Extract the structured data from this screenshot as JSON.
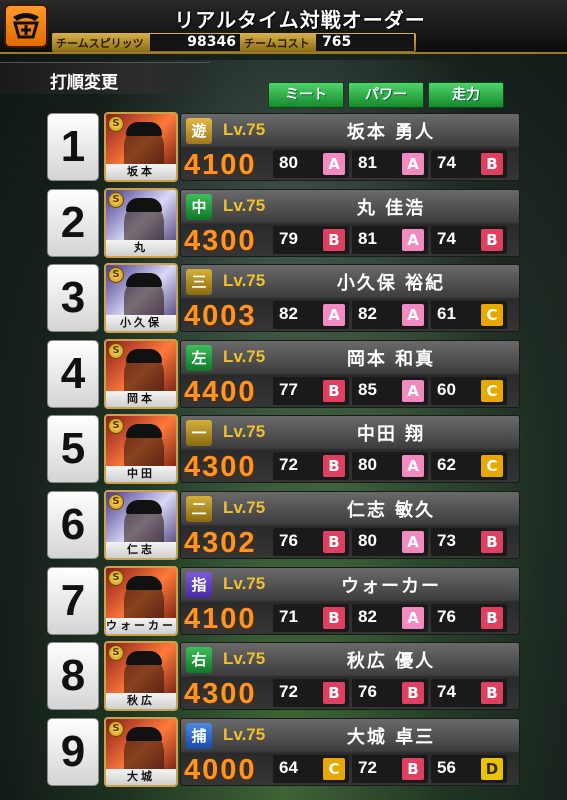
{
  "header": {
    "title": "リアルタイム対戦オーダー",
    "spirit_label": "チームスピリッツ",
    "spirit_value": "98346",
    "cost_label": "チームコスト",
    "cost_value": "765",
    "logo_icon": "giants-logo-icon"
  },
  "tab": {
    "label": "打順変更"
  },
  "sort_buttons": [
    {
      "label": "ミート"
    },
    {
      "label": "パワー"
    },
    {
      "label": "走力"
    }
  ],
  "players": [
    {
      "order": "1",
      "position": "遊",
      "pos_class": "pos-ss",
      "level": "Lv.75",
      "name": "坂本 勇人",
      "card_name": "坂本",
      "power": "4100",
      "meet": "80",
      "meet_grade": "A",
      "pwr": "81",
      "pwr_grade": "A",
      "speed": "74",
      "speed_grade": "B",
      "portrait": "p-red"
    },
    {
      "order": "2",
      "position": "中",
      "pos_class": "pos-of",
      "level": "Lv.75",
      "name": "丸 佳浩",
      "card_name": "丸",
      "power": "4300",
      "meet": "79",
      "meet_grade": "B",
      "pwr": "81",
      "pwr_grade": "A",
      "speed": "74",
      "speed_grade": "B",
      "portrait": "p-purple"
    },
    {
      "order": "3",
      "position": "三",
      "pos_class": "pos-if",
      "level": "Lv.75",
      "name": "小久保 裕紀",
      "card_name": "小久保",
      "power": "4003",
      "meet": "82",
      "meet_grade": "A",
      "pwr": "82",
      "pwr_grade": "A",
      "speed": "61",
      "speed_grade": "C",
      "portrait": "p-purple"
    },
    {
      "order": "4",
      "position": "左",
      "pos_class": "pos-of",
      "level": "Lv.75",
      "name": "岡本 和真",
      "card_name": "岡本",
      "power": "4400",
      "meet": "77",
      "meet_grade": "B",
      "pwr": "85",
      "pwr_grade": "A",
      "speed": "60",
      "speed_grade": "C",
      "portrait": "p-red"
    },
    {
      "order": "5",
      "position": "一",
      "pos_class": "pos-if",
      "level": "Lv.75",
      "name": "中田 翔",
      "card_name": "中田",
      "power": "4300",
      "meet": "72",
      "meet_grade": "B",
      "pwr": "80",
      "pwr_grade": "A",
      "speed": "62",
      "speed_grade": "C",
      "portrait": "p-red"
    },
    {
      "order": "6",
      "position": "二",
      "pos_class": "pos-if",
      "level": "Lv.75",
      "name": "仁志 敏久",
      "card_name": "仁志",
      "power": "4302",
      "meet": "76",
      "meet_grade": "B",
      "pwr": "80",
      "pwr_grade": "A",
      "speed": "73",
      "speed_grade": "B",
      "portrait": "p-purple"
    },
    {
      "order": "7",
      "position": "指",
      "pos_class": "pos-dh",
      "level": "Lv.75",
      "name": "ウォーカー",
      "card_name": "ウォーカー",
      "power": "4100",
      "meet": "71",
      "meet_grade": "B",
      "pwr": "82",
      "pwr_grade": "A",
      "speed": "76",
      "speed_grade": "B",
      "portrait": "p-red"
    },
    {
      "order": "8",
      "position": "右",
      "pos_class": "pos-of",
      "level": "Lv.75",
      "name": "秋広 優人",
      "card_name": "秋広",
      "power": "4300",
      "meet": "72",
      "meet_grade": "B",
      "pwr": "76",
      "pwr_grade": "B",
      "speed": "74",
      "speed_grade": "B",
      "portrait": "p-red"
    },
    {
      "order": "9",
      "position": "捕",
      "pos_class": "pos-c",
      "level": "Lv.75",
      "name": "大城 卓三",
      "card_name": "大城",
      "power": "4000",
      "meet": "64",
      "meet_grade": "C",
      "pwr": "72",
      "pwr_grade": "B",
      "speed": "56",
      "speed_grade": "D",
      "portrait": "p-red"
    }
  ]
}
